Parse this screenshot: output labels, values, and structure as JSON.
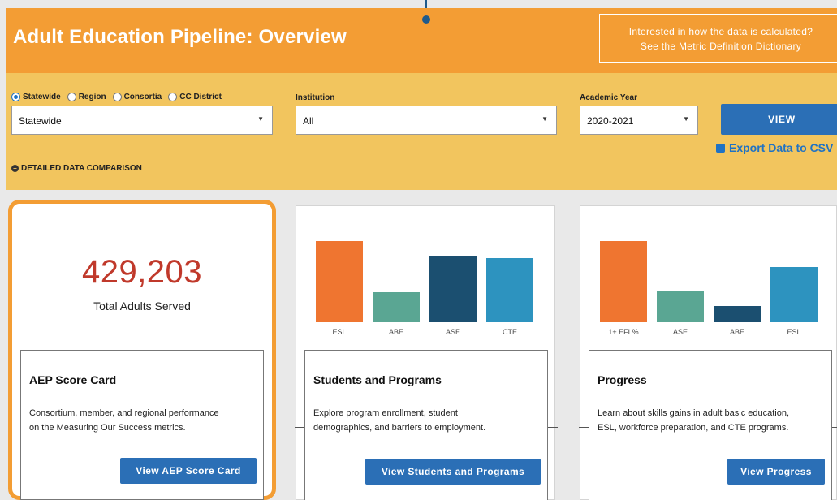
{
  "header": {
    "title": "Adult Education Pipeline: Overview",
    "dictionary_line1": "Interested in how the data is calculated?",
    "dictionary_line2": "See the Metric Definition Dictionary"
  },
  "filters": {
    "scope_options": [
      "Statewide",
      "Region",
      "Consortia",
      "CC District"
    ],
    "scope_selected": "Statewide",
    "scope_value": "Statewide",
    "institution_label": "Institution",
    "institution_value": "All",
    "year_label": "Academic Year",
    "year_value": "2020-2021",
    "view_button": "VIEW",
    "export_link": "Export Data to CSV",
    "detail_toggle": "DETAILED DATA COMPARISON"
  },
  "scorecard": {
    "total_value": "429,203",
    "total_label": "Total Adults Served",
    "title": "AEP Score Card",
    "desc_line1": "Consortium, member, and regional performance",
    "desc_line2": "on the Measuring Our Success metrics.",
    "button": "View AEP Score Card"
  },
  "students": {
    "title": "Students and Programs",
    "desc_line1": "Explore program enrollment, student",
    "desc_line2": "demographics, and barriers to employment.",
    "button": "View Students and Programs"
  },
  "progress": {
    "title": "Progress",
    "desc_line1": "Learn about skills gains in adult basic education,",
    "desc_line2": "ESL, workforce preparation, and CTE programs.",
    "button": "View Progress"
  },
  "colors": {
    "header_orange": "#f39d34",
    "filter_yellow": "#f2c55e",
    "button_blue": "#2b6fb6",
    "bar_orange": "#ef7530",
    "bar_teal": "#5aa693",
    "bar_navy": "#1b4f70",
    "bar_blue": "#2d93bf",
    "number_red": "#c0392b"
  },
  "chart_data": [
    {
      "type": "bar",
      "categories": [
        "ESL",
        "ABE",
        "ASE",
        "CTE"
      ],
      "values": [
        100,
        37,
        81,
        79
      ],
      "colors": [
        "#ef7530",
        "#5aa693",
        "#1b4f70",
        "#2d93bf"
      ],
      "ylim": [
        0,
        100
      ]
    },
    {
      "type": "bar",
      "categories": [
        "1+ EFL%",
        "ASE",
        "ABE",
        "ESL"
      ],
      "values": [
        100,
        38,
        20,
        68
      ],
      "colors": [
        "#ef7530",
        "#5aa693",
        "#1b4f70",
        "#2d93bf"
      ],
      "ylim": [
        0,
        100
      ]
    }
  ]
}
